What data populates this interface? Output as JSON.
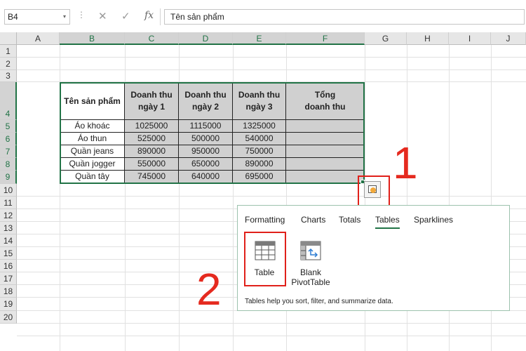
{
  "formula_bar": {
    "name_box": "B4",
    "dropdown_glyph": "▾",
    "dots_glyph": "⋮",
    "cancel_glyph": "✕",
    "enter_glyph": "✓",
    "fx_label": "fx",
    "formula_value": "Tên sản phẩm"
  },
  "columns": [
    "A",
    "B",
    "C",
    "D",
    "E",
    "F",
    "G",
    "H",
    "I",
    "J"
  ],
  "rows": [
    "1",
    "2",
    "3",
    "4",
    "5",
    "6",
    "7",
    "8",
    "9",
    "10",
    "11",
    "12",
    "13",
    "14",
    "15",
    "16",
    "17",
    "18",
    "19",
    "20"
  ],
  "table": {
    "headers": [
      "Tên sản phẩm",
      "Doanh thu\nngày 1",
      "Doanh thu\nngày 2",
      "Doanh thu\nngày 3",
      "Tổng\ndoanh thu"
    ],
    "rows": [
      [
        "Áo khoác",
        "1025000",
        "1115000",
        "1325000",
        ""
      ],
      [
        "Áo thun",
        "525000",
        "500000",
        "540000",
        ""
      ],
      [
        "Quần jeans",
        "890000",
        "950000",
        "750000",
        ""
      ],
      [
        "Quần jogger",
        "550000",
        "650000",
        "890000",
        ""
      ],
      [
        "Quần tây",
        "745000",
        "640000",
        "695000",
        ""
      ]
    ]
  },
  "quick_analysis": {
    "tabs": [
      "Formatting",
      "Charts",
      "Totals",
      "Tables",
      "Sparklines"
    ],
    "active_tab": "Tables",
    "items": [
      {
        "icon": "table-icon",
        "label": "Table"
      },
      {
        "icon": "pivot-table-icon",
        "label": "Blank\nPivotTable"
      }
    ],
    "description": "Tables help you sort, filter, and summarize data."
  },
  "annotations": {
    "step1": "1",
    "step2": "2",
    "highlight_color": "#e0201a"
  },
  "colors": {
    "excel_green": "#217346",
    "table_fill": "#d0d0d0"
  }
}
